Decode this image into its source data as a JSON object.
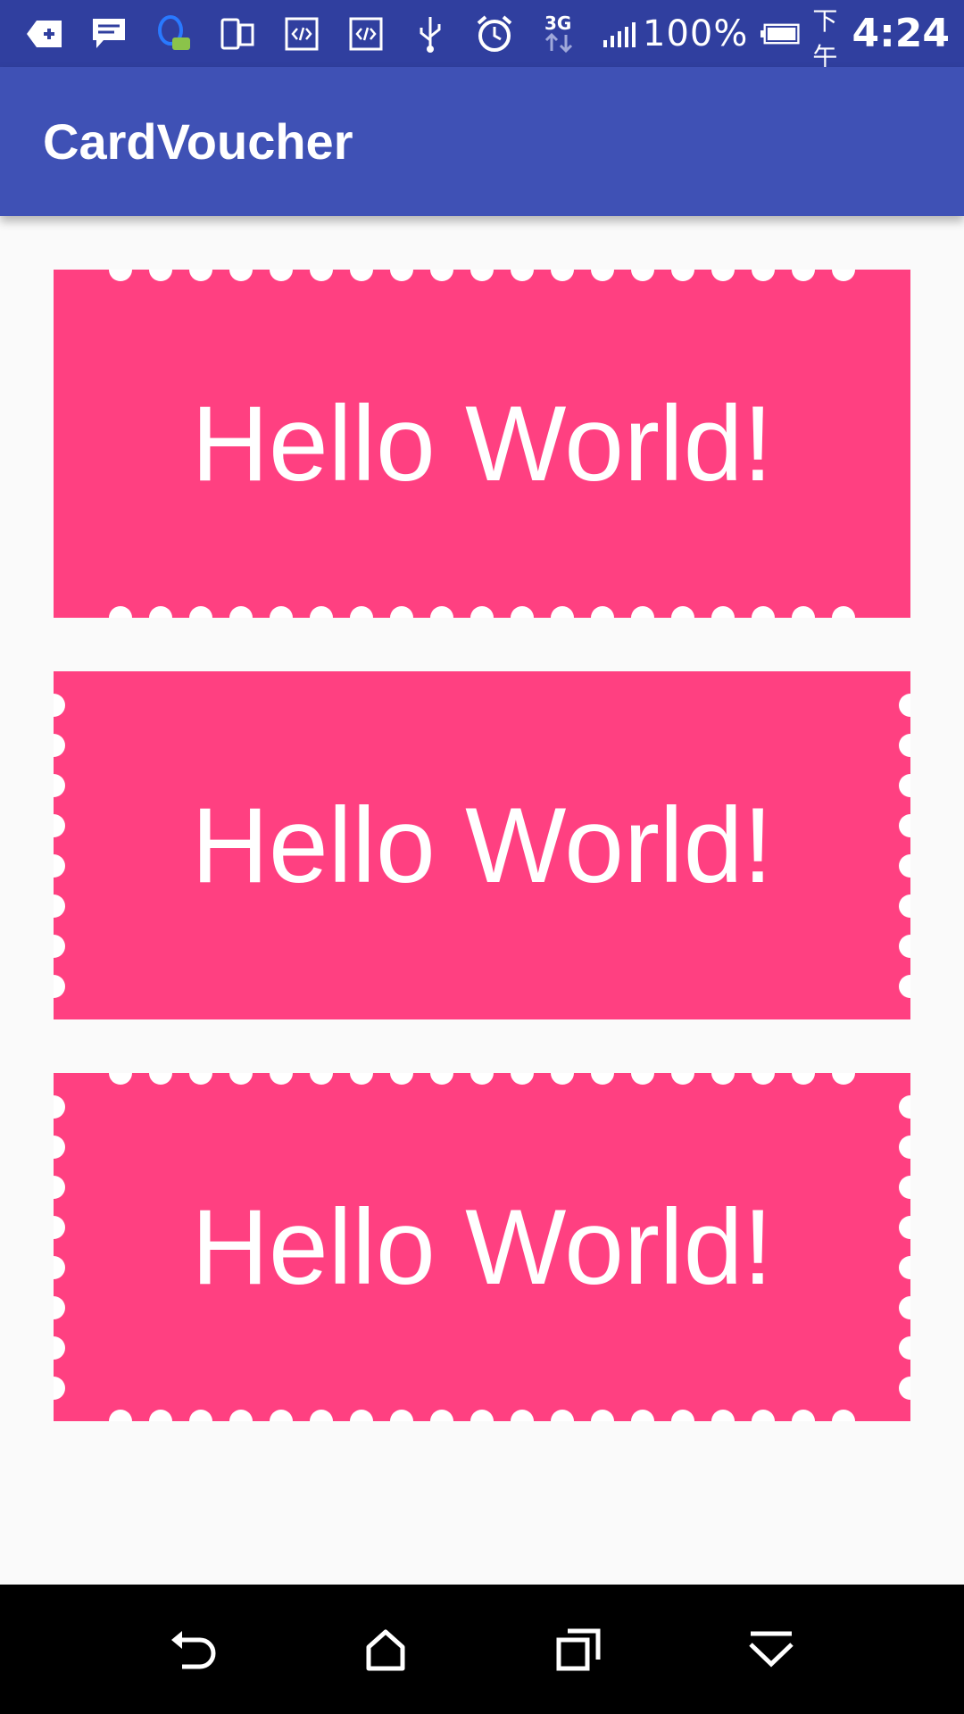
{
  "status_bar": {
    "battery_percent": "100%",
    "time_prefix": "下午",
    "time": "4:24",
    "network": "3G",
    "icons": [
      "add-notification-icon",
      "message-icon",
      "qq-icon",
      "phone-dual-icon",
      "code-icon",
      "code-icon",
      "usb-icon",
      "alarm-icon",
      "network-3g-icon",
      "signal-icon",
      "battery-icon"
    ]
  },
  "app_bar": {
    "title": "CardVoucher"
  },
  "cards": [
    {
      "text": "Hello World!",
      "holes": "top-bottom"
    },
    {
      "text": "Hello World!",
      "holes": "left-right"
    },
    {
      "text": "Hello World!",
      "holes": "all-sides"
    }
  ],
  "nav_bar": {
    "icons": [
      "back-icon",
      "home-icon",
      "recents-icon",
      "dropdown-icon"
    ]
  },
  "colors": {
    "status_bar": "#303f9f",
    "app_bar": "#3f51b5",
    "card": "#ff4081",
    "background": "#fafafa"
  }
}
